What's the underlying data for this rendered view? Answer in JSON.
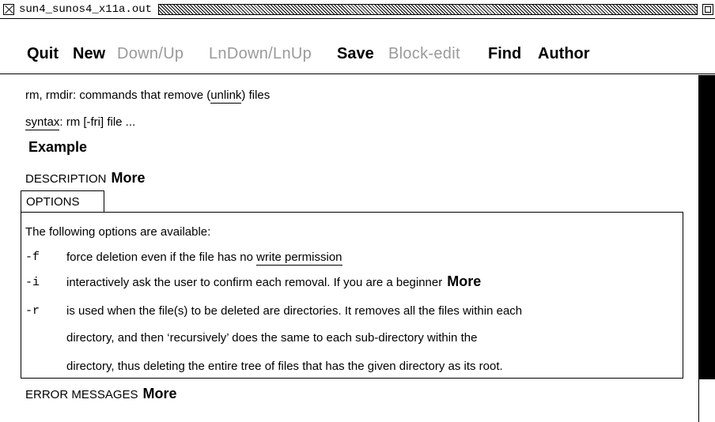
{
  "window": {
    "title": "sun4_sunos4_x11a.out"
  },
  "menu": {
    "quit": "Quit",
    "new": "New",
    "down_up": "Down/Up",
    "lndown_lnup": "LnDown/LnUp",
    "save": "Save",
    "block_edit": "Block-edit",
    "find": "Find",
    "author": "Author"
  },
  "doc": {
    "heading_prefix": "rm, rmdir: commands that remove (",
    "heading_link": "unlink",
    "heading_suffix": ") files",
    "syntax_link": "syntax",
    "syntax_text": ": rm [-fri] file ...",
    "example": "Example",
    "description_label": "DESCRIPTION",
    "description_more": "More",
    "options_label": "OPTIONS",
    "options_intro": "The following options are available:",
    "options": [
      {
        "flag": "-f",
        "text_prefix": "force deletion even if the file has no ",
        "link": "write permission",
        "more": ""
      },
      {
        "flag": "-i",
        "text_prefix": "interactively ask the user to confirm each removal.  If you are a beginner",
        "link": "",
        "more": "More"
      },
      {
        "flag": "-r",
        "text_prefix": "is used when the file(s) to be deleted are directories. It removes all the files within each",
        "link": "",
        "more": ""
      }
    ],
    "r_cont1": "directory, and then ‘recursively’ does the same to each sub-directory within the",
    "r_cont2": "directory, thus deleting the entire tree of files that has the given directory as its root.",
    "errors_label": "ERROR MESSAGES",
    "errors_more": "More"
  }
}
